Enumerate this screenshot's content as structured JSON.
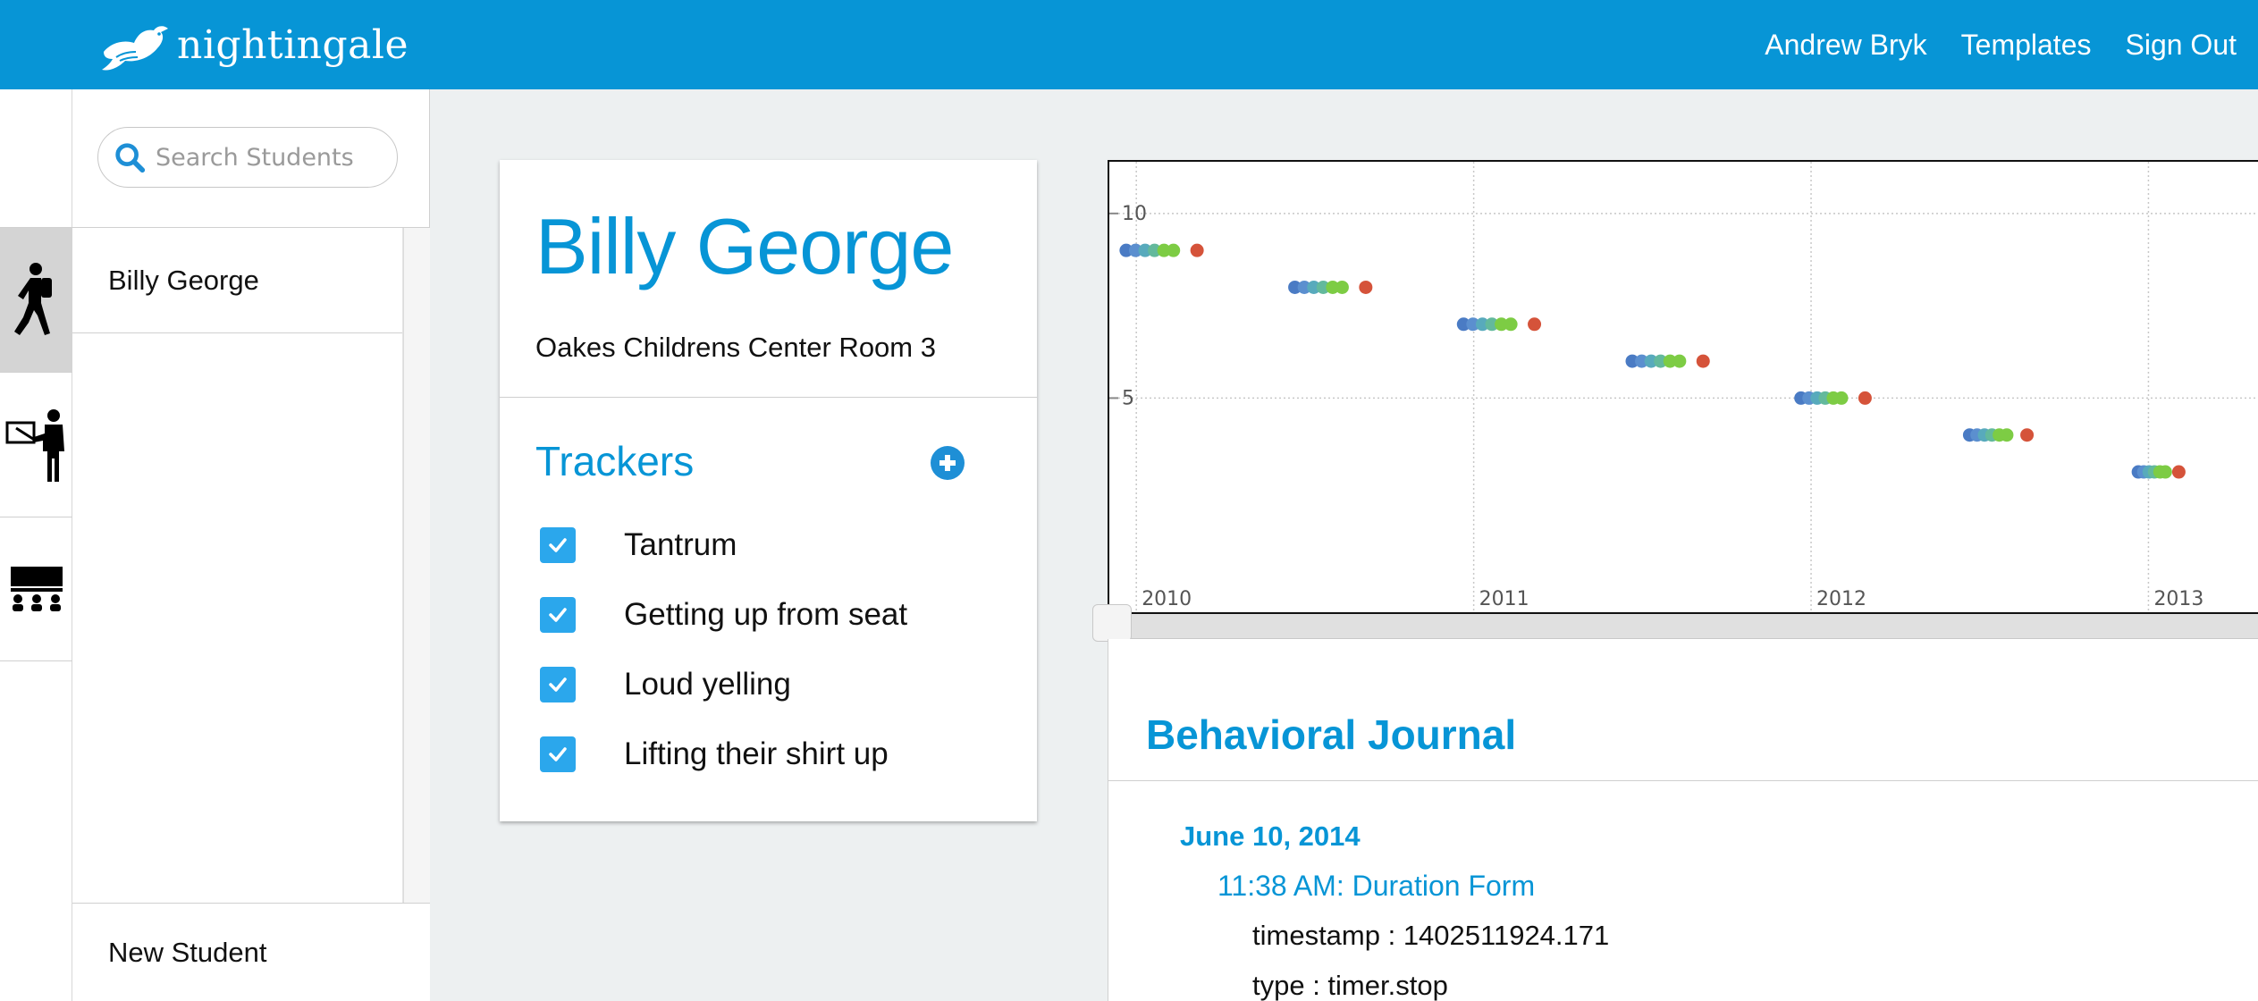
{
  "app": {
    "brand": "nightingale",
    "nav": [
      "Andrew Bryk",
      "Templates",
      "Sign Out"
    ]
  },
  "rail": {
    "items": [
      {
        "icon": "student-walking-icon",
        "active": true
      },
      {
        "icon": "teacher-presenting-icon",
        "active": false
      },
      {
        "icon": "classroom-icon",
        "active": false
      }
    ]
  },
  "search": {
    "placeholder": "Search Students"
  },
  "students": {
    "items": [
      "Billy George"
    ],
    "new_label": "New Student"
  },
  "profile": {
    "name": "Billy George",
    "school": "Oakes Childrens Center Room 3",
    "trackers_title": "Trackers",
    "trackers": [
      {
        "label": "Tantrum",
        "checked": true
      },
      {
        "label": "Getting up from seat",
        "checked": true
      },
      {
        "label": "Loud yelling",
        "checked": true
      },
      {
        "label": "Lifting their shirt up",
        "checked": true
      }
    ]
  },
  "chart_data": {
    "type": "scatter",
    "title": "",
    "xlabel": "",
    "ylabel": "",
    "x_ticks": [
      "2010",
      "2011",
      "2012",
      "2013"
    ],
    "y_ticks": [
      10,
      5
    ],
    "xlim": [
      2009.92,
      2013.33
    ],
    "ylim": [
      -0.8,
      11.4
    ],
    "grid": true,
    "colors": [
      "#4a7bc4",
      "#5b8fcf",
      "#58aabc",
      "#63b99c",
      "#7dcc44",
      "#d5533a"
    ],
    "groups": [
      {
        "x_start": 2009.97,
        "x_end": 2010.11,
        "x_outlier": 2010.18,
        "y": 9
      },
      {
        "x_start": 2010.47,
        "x_end": 2010.61,
        "x_outlier": 2010.68,
        "y": 8
      },
      {
        "x_start": 2010.97,
        "x_end": 2011.11,
        "x_outlier": 2011.18,
        "y": 7
      },
      {
        "x_start": 2011.47,
        "x_end": 2011.61,
        "x_outlier": 2011.68,
        "y": 6
      },
      {
        "x_start": 2011.97,
        "x_end": 2012.09,
        "x_outlier": 2012.16,
        "y": 5
      },
      {
        "x_start": 2012.47,
        "x_end": 2012.58,
        "x_outlier": 2012.64,
        "y": 4
      },
      {
        "x_start": 2012.97,
        "x_end": 2013.05,
        "x_outlier": 2013.09,
        "y": 3
      }
    ]
  },
  "journal": {
    "title": "Behavioral Journal",
    "date": "June 10, 2014",
    "entry": "11:38 AM: Duration Form",
    "fields": [
      "timestamp : 1402511924.171",
      "type : timer.stop"
    ]
  }
}
